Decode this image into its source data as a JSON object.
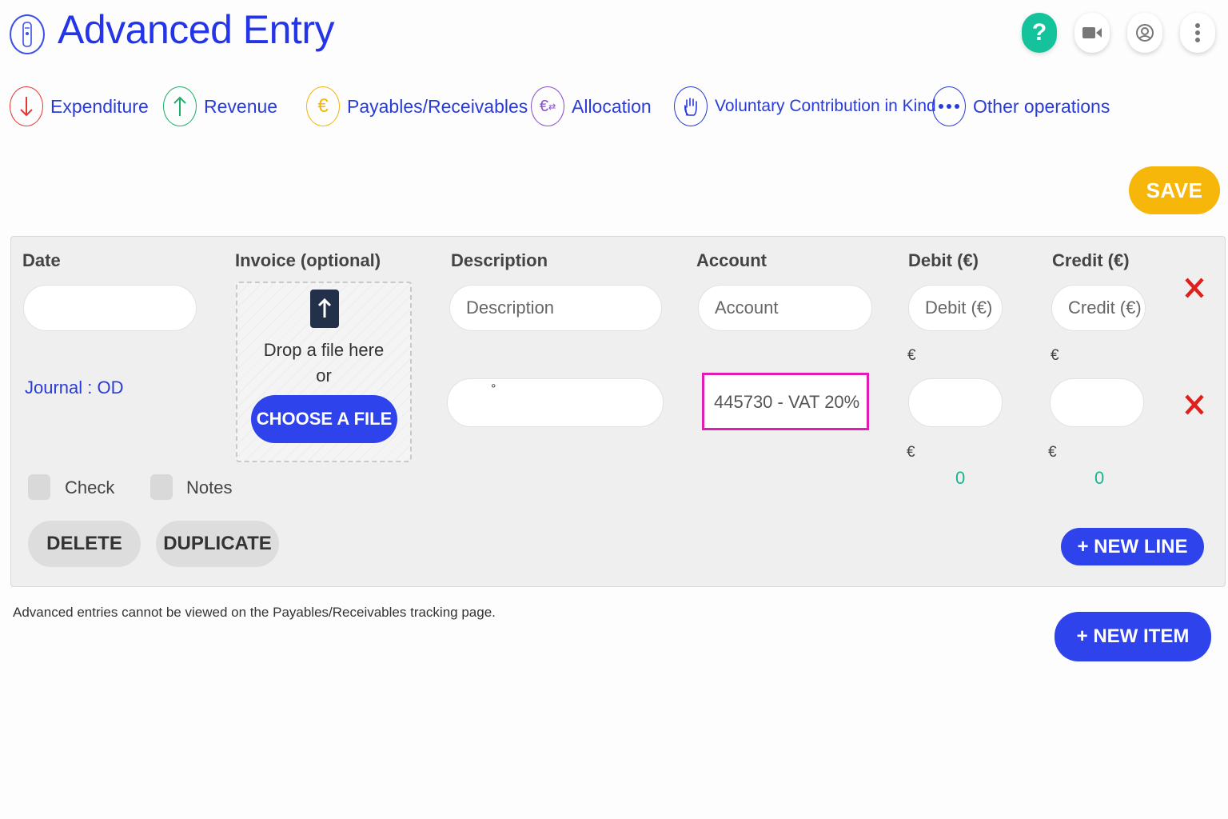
{
  "header": {
    "title": "Advanced Entry",
    "help_label": "?",
    "icons": [
      "flashlight-icon",
      "help-icon",
      "video-icon",
      "user-icon",
      "more-vertical-icon"
    ]
  },
  "operations": [
    {
      "label": "Expenditure",
      "icon": "arrow-down-icon",
      "color": "#e53935"
    },
    {
      "label": "Revenue",
      "icon": "arrow-up-icon",
      "color": "#1fae6a"
    },
    {
      "label": "Payables/Receivables",
      "icon": "euro-icon",
      "color": "#f2b60c"
    },
    {
      "label": "Allocation",
      "icon": "euro-exchange-icon",
      "color": "#8a4fc9"
    },
    {
      "label": "Voluntary Contribution in Kind",
      "icon": "hand-icon",
      "color": "#2a3cd8"
    },
    {
      "label": "Other operations",
      "icon": "dots-icon",
      "color": "#2a3cd8"
    }
  ],
  "toolbar": {
    "save_label": "SAVE"
  },
  "form": {
    "headers": {
      "date": "Date",
      "invoice": "Invoice (optional)",
      "description": "Description",
      "account": "Account",
      "debit": "Debit (€)",
      "credit": "Credit (€)"
    },
    "placeholders": {
      "description": "Description",
      "account": "Account",
      "debit": "Debit (€)",
      "credit": "Credit (€)"
    },
    "dropzone": {
      "text": "Drop a file here",
      "or": "or",
      "button": "CHOOSE A FILE"
    },
    "journal": "Journal : OD",
    "line2": {
      "description_value": "°",
      "account_value": "445730 - VAT 20%"
    },
    "currency_symbol": "€",
    "totals": {
      "debit": "0",
      "credit": "0"
    },
    "checkboxes": {
      "check": "Check",
      "notes": "Notes"
    },
    "buttons": {
      "delete": "DELETE",
      "duplicate": "DUPLICATE",
      "new_line": "+ NEW LINE"
    },
    "delete_mark": "✕"
  },
  "footer": {
    "note": "Advanced entries cannot be viewed on the Payables/Receivables tracking page.",
    "new_item": "+ NEW ITEM"
  },
  "colors": {
    "accent": "#2f43ec",
    "save": "#f6b60a",
    "help": "#14c39b",
    "highlight": "#e21bb5",
    "total": "#16b58e",
    "delete": "#e0201c"
  }
}
